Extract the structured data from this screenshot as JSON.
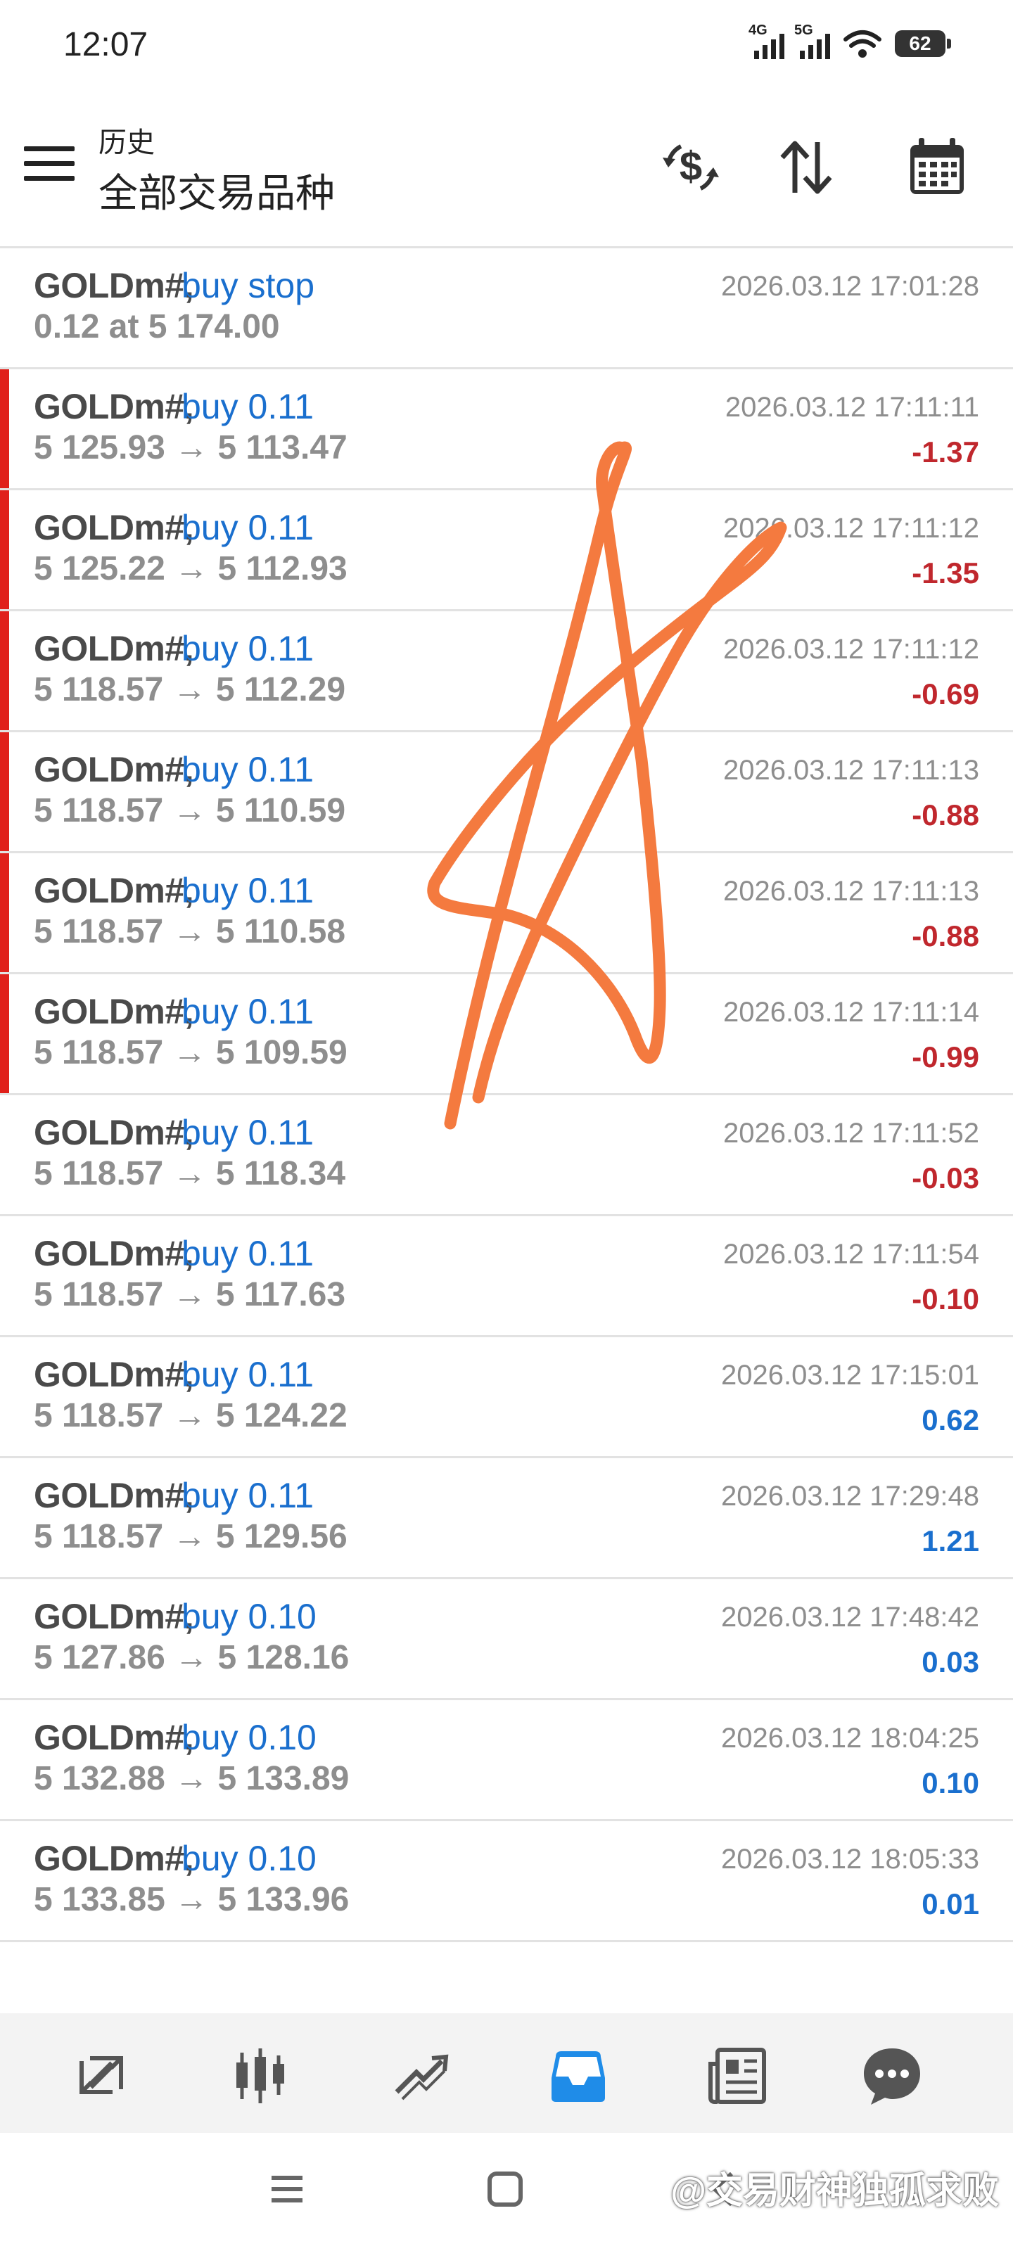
{
  "status_bar": {
    "time": "12:07",
    "network_1": "4G",
    "network_2": "5G",
    "battery": "62"
  },
  "header": {
    "subtitle": "历史",
    "title": "全部交易品种",
    "icons": [
      "currency-exchange-icon",
      "sort-icon",
      "calendar-icon"
    ]
  },
  "orders": [
    {
      "symbol": "GOLDm#,",
      "side": "buy stop",
      "prices": "0.12 at 5 174.00",
      "time": "2026.03.12 17:01:28",
      "profit": "",
      "marked": false
    },
    {
      "symbol": "GOLDm#,",
      "side": "buy 0.11",
      "prices": "5 125.93 → 5 113.47",
      "time": "2026.03.12 17:11:11",
      "profit": "-1.37",
      "marked": true
    },
    {
      "symbol": "GOLDm#,",
      "side": "buy 0.11",
      "prices": "5 125.22 → 5 112.93",
      "time": "2026.03.12 17:11:12",
      "profit": "-1.35",
      "marked": true
    },
    {
      "symbol": "GOLDm#,",
      "side": "buy 0.11",
      "prices": "5 118.57 → 5 112.29",
      "time": "2026.03.12 17:11:12",
      "profit": "-0.69",
      "marked": true
    },
    {
      "symbol": "GOLDm#,",
      "side": "buy 0.11",
      "prices": "5 118.57 → 5 110.59",
      "time": "2026.03.12 17:11:13",
      "profit": "-0.88",
      "marked": true
    },
    {
      "symbol": "GOLDm#,",
      "side": "buy 0.11",
      "prices": "5 118.57 → 5 110.58",
      "time": "2026.03.12 17:11:13",
      "profit": "-0.88",
      "marked": true
    },
    {
      "symbol": "GOLDm#,",
      "side": "buy 0.11",
      "prices": "5 118.57 → 5 109.59",
      "time": "2026.03.12 17:11:14",
      "profit": "-0.99",
      "marked": true
    },
    {
      "symbol": "GOLDm#,",
      "side": "buy 0.11",
      "prices": "5 118.57 → 5 118.34",
      "time": "2026.03.12 17:11:52",
      "profit": "-0.03",
      "marked": false
    },
    {
      "symbol": "GOLDm#,",
      "side": "buy 0.11",
      "prices": "5 118.57 → 5 117.63",
      "time": "2026.03.12 17:11:54",
      "profit": "-0.10",
      "marked": false
    },
    {
      "symbol": "GOLDm#,",
      "side": "buy 0.11",
      "prices": "5 118.57 → 5 124.22",
      "time": "2026.03.12 17:15:01",
      "profit": "0.62",
      "marked": false
    },
    {
      "symbol": "GOLDm#,",
      "side": "buy 0.11",
      "prices": "5 118.57 → 5 129.56",
      "time": "2026.03.12 17:29:48",
      "profit": "1.21",
      "marked": false
    },
    {
      "symbol": "GOLDm#,",
      "side": "buy 0.10",
      "prices": "5 127.86 → 5 128.16",
      "time": "2026.03.12 17:48:42",
      "profit": "0.03",
      "marked": false
    },
    {
      "symbol": "GOLDm#,",
      "side": "buy 0.10",
      "prices": "5 132.88 → 5 133.89",
      "time": "2026.03.12 18:04:25",
      "profit": "0.10",
      "marked": false
    },
    {
      "symbol": "GOLDm#,",
      "side": "buy 0.10",
      "prices": "5 133.85 → 5 133.96",
      "time": "2026.03.12 18:05:33",
      "profit": "0.01",
      "marked": false
    }
  ],
  "bottom_nav": {
    "items": [
      "quotes-icon",
      "chart-icon",
      "trade-icon",
      "history-icon",
      "news-icon",
      "chat-icon"
    ],
    "active": "history-icon"
  },
  "watermark": "@交易财神独孤求败",
  "colors": {
    "accent": "#1a6fce",
    "loss": "#c0272d",
    "loss_marker": "#e0201b",
    "scribble": "#f47a3f"
  }
}
